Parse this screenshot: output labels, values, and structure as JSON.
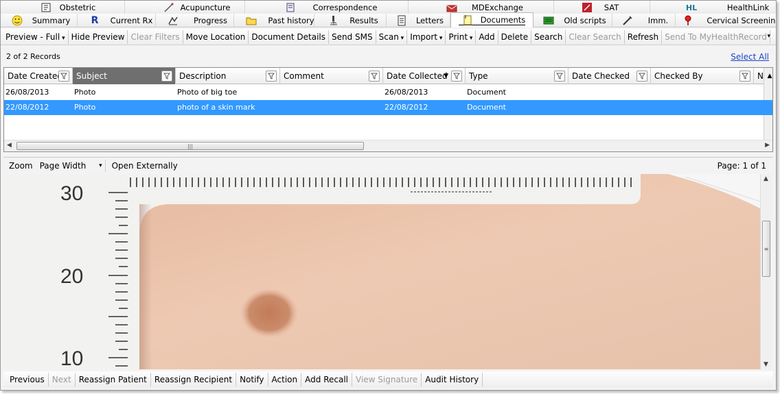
{
  "tabs_row1": [
    {
      "label": "Obstetric",
      "icon": "obstetric-icon"
    },
    {
      "label": "Acupuncture",
      "icon": "acupuncture-needle-icon"
    },
    {
      "label": "Correspondence",
      "icon": "correspondence-icon"
    },
    {
      "label": "MDExchange",
      "icon": "mdexchange-icon"
    },
    {
      "label": "SAT",
      "icon": "sat-icon"
    },
    {
      "label": "HealthLink",
      "icon": "healthlink-icon"
    }
  ],
  "tabs_row2": [
    {
      "label": "Summary",
      "icon": "smiley-icon"
    },
    {
      "label": "Current Rx",
      "icon": "rx-icon"
    },
    {
      "label": "Progress",
      "icon": "progress-icon"
    },
    {
      "label": "Past history",
      "icon": "folder-icon"
    },
    {
      "label": "Results",
      "icon": "microscope-icon"
    },
    {
      "label": "Letters",
      "icon": "letter-icon"
    },
    {
      "label": "Documents",
      "icon": "documents-icon",
      "active": true
    },
    {
      "label": "Old scripts",
      "icon": "old-scripts-icon"
    },
    {
      "label": "Imm.",
      "icon": "syringe-icon"
    },
    {
      "label": "Cervical Screening",
      "icon": "cervical-screening-icon"
    }
  ],
  "toolbar": [
    {
      "label": "Preview - Full",
      "dropdown": true
    },
    {
      "label": "Hide Preview"
    },
    {
      "label": "Clear Filters",
      "disabled": true
    },
    {
      "label": "Move Location"
    },
    {
      "label": "Document Details"
    },
    {
      "label": "Send SMS"
    },
    {
      "label": "Scan",
      "dropdown": true
    },
    {
      "label": "Import",
      "dropdown": true
    },
    {
      "label": "Print",
      "dropdown": true
    },
    {
      "label": "Add"
    },
    {
      "label": "Delete"
    },
    {
      "label": "Search"
    },
    {
      "label": "Clear Search",
      "disabled": true
    },
    {
      "label": "Refresh"
    },
    {
      "label": "Send To MyHealthRecord",
      "disabled": true
    }
  ],
  "records": {
    "count_text": "2 of 2 Records",
    "select_all": "Select All"
  },
  "columns": [
    {
      "label": "Date Created",
      "filter": true
    },
    {
      "label": "Subject",
      "filter": true,
      "selected": true
    },
    {
      "label": "Description",
      "filter": true
    },
    {
      "label": "Comment",
      "filter": true
    },
    {
      "label": "Date Collected",
      "filter": true,
      "sorted": true
    },
    {
      "label": "Type",
      "filter": true
    },
    {
      "label": "Date Checked",
      "filter": true
    },
    {
      "label": "Checked By",
      "filter": true
    },
    {
      "label": "Nota",
      "filter": false
    }
  ],
  "rows": [
    {
      "cells": [
        "26/08/2013",
        "Photo",
        "Photo of big toe",
        "",
        "26/08/2013",
        "Document",
        "",
        "",
        ""
      ],
      "selected": false
    },
    {
      "cells": [
        "22/08/2012",
        "Photo",
        "photo of a skin mark",
        "",
        "22/08/2012",
        "Document",
        "",
        "",
        ""
      ],
      "selected": true
    }
  ],
  "viewer": {
    "zoom_label": "Zoom",
    "zoom_value": "Page Width",
    "open_externally": "Open Externally",
    "page_text": "Page: 1 of 1",
    "ruler_labels": [
      "30",
      "20",
      "10"
    ]
  },
  "bottom_toolbar": [
    {
      "label": "Previous"
    },
    {
      "label": "Next",
      "disabled": true
    },
    {
      "label": "Reassign Patient"
    },
    {
      "label": "Reassign Recipient"
    },
    {
      "label": "Notify"
    },
    {
      "label": "Action"
    },
    {
      "label": "Add Recall"
    },
    {
      "label": "View Signature",
      "disabled": true
    },
    {
      "label": "Audit History"
    }
  ],
  "colors": {
    "selection": "#3399ff",
    "link": "#1a44c8",
    "skin": "#e9d4c7",
    "mole": "#c8886a",
    "ruler": "#f4f4f4"
  }
}
